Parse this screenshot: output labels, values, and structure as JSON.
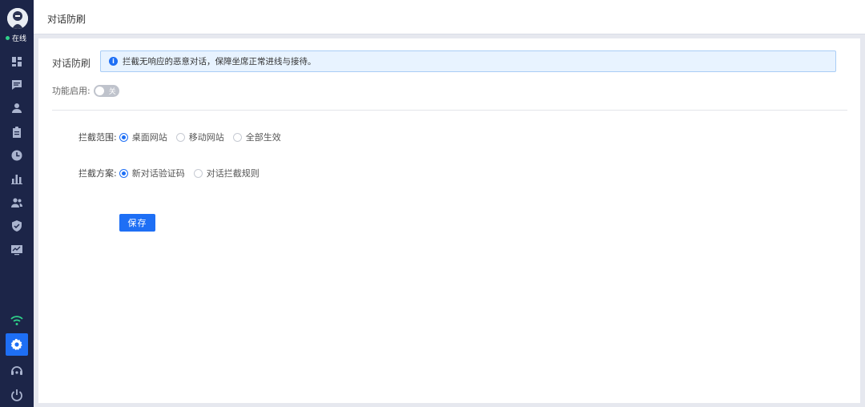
{
  "sidebar": {
    "status_text": "在线",
    "nav_icons": [
      "dashboard-icon",
      "chat-icon",
      "user-icon",
      "clipboard-icon",
      "clock-icon",
      "bar-chart-icon",
      "team-icon",
      "shield-icon",
      "monitor-chart-icon"
    ],
    "bottom_icons": [
      "wifi-icon",
      "settings-icon",
      "headset-icon",
      "power-icon"
    ],
    "colors": {
      "background": "#1c2548",
      "active": "#1e6ff5",
      "wifi": "#2fd18a"
    }
  },
  "header": {
    "title": "对话防刷"
  },
  "main": {
    "section_label": "对话防刷",
    "alert_text": "拦截无响应的恶意对话，保障坐席正常进线与接待。",
    "enable_label": "功能启用:",
    "toggle_text": "关",
    "toggle_on": false,
    "scope": {
      "label": "拦截范围:",
      "options": [
        "桌面网站",
        "移动网站",
        "全部生效"
      ],
      "selected": "桌面网站"
    },
    "scheme": {
      "label": "拦截方案:",
      "options": [
        "新对话验证码",
        "对话拦截规则"
      ],
      "selected": "新对话验证码"
    },
    "save_label": "保存"
  }
}
